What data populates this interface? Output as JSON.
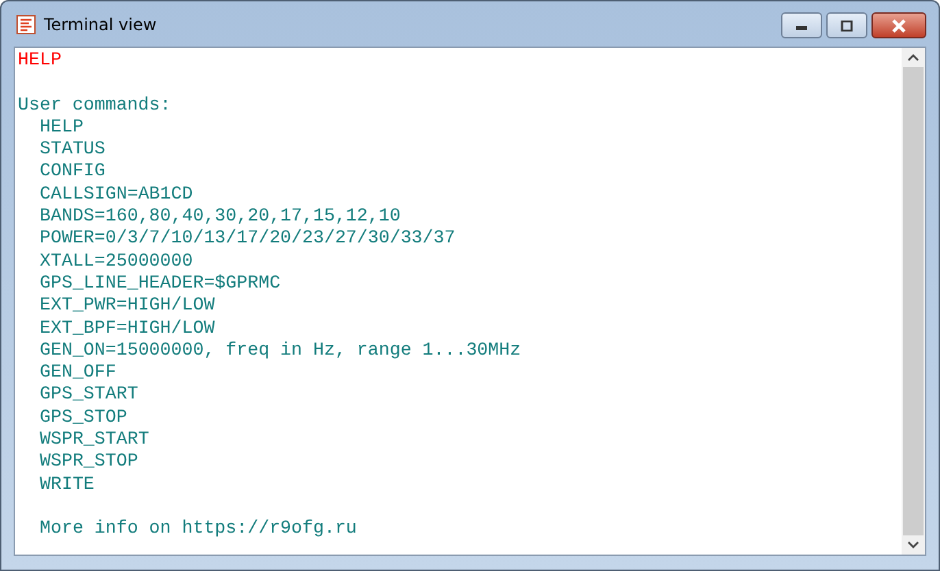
{
  "window": {
    "title": "Terminal view"
  },
  "lines": [
    {
      "kind": "echo",
      "text": "HELP"
    },
    {
      "kind": "heading",
      "text": "User commands:",
      "children": [
        "HELP",
        "STATUS",
        "CONFIG",
        "CALLSIGN=AB1CD",
        "BANDS=160,80,40,30,20,17,15,12,10",
        "POWER=0/3/7/10/13/17/20/23/27/30/33/37",
        "XTALL=25000000",
        "GPS_LINE_HEADER=$GPRMC",
        "EXT_PWR=HIGH/LOW",
        "EXT_BPF=HIGH/LOW",
        "GEN_ON=15000000, freq in Hz, range 1...30MHz",
        "GEN_OFF",
        "GPS_START",
        "GPS_STOP",
        "WSPR_START",
        "WSPR_STOP",
        "WRITE"
      ]
    },
    {
      "kind": "note",
      "text": "More info on https://r9ofg.ru"
    }
  ]
}
